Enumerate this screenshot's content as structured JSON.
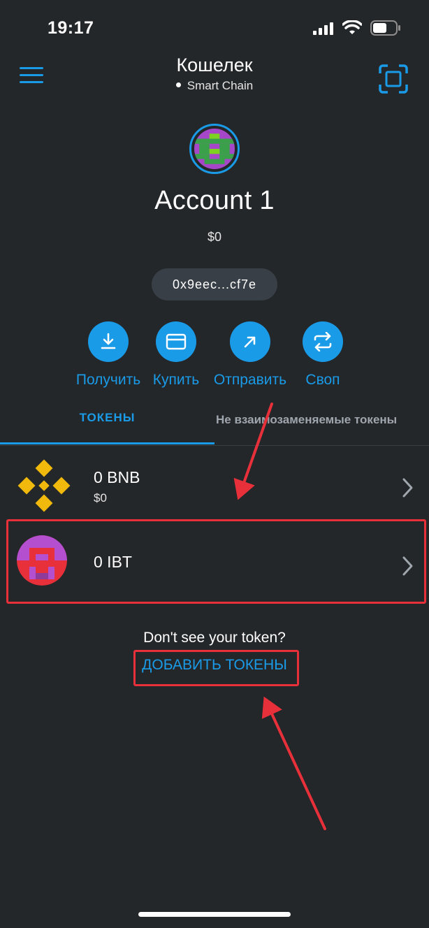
{
  "status_bar": {
    "time": "19:17"
  },
  "header": {
    "title": "Кошелек",
    "network": "Smart Chain"
  },
  "account": {
    "name": "Account 1",
    "balance": "$0",
    "address": "0x9eec...cf7e"
  },
  "actions": [
    {
      "label": "Получить",
      "icon": "receive-icon"
    },
    {
      "label": "Купить",
      "icon": "card-icon"
    },
    {
      "label": "Отправить",
      "icon": "send-icon"
    },
    {
      "label": "Своп",
      "icon": "swap-icon"
    }
  ],
  "tabs": {
    "tokens": "ТОКЕНЫ",
    "nft": "Не взаимозаменяемые токены"
  },
  "tokens": [
    {
      "name": "0 BNB",
      "fiat": "$0",
      "icon": "bnb-logo"
    },
    {
      "name": "0 IBT",
      "fiat": "",
      "icon": "ibt-identicon"
    }
  ],
  "footer": {
    "prompt": "Don't see your token?",
    "add_tokens": "ДОБАВИТЬ ТОКЕНЫ"
  },
  "colors": {
    "background": "#24272a",
    "accent": "#1a9be8",
    "annotation": "#e8303a"
  }
}
